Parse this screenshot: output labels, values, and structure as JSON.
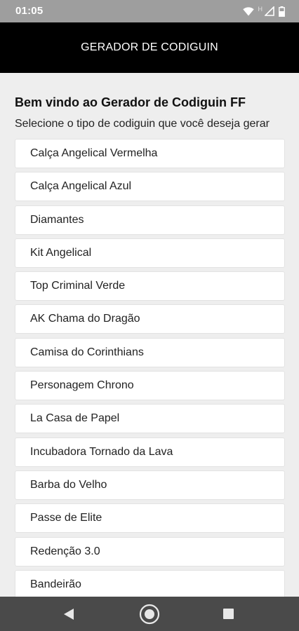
{
  "status_bar": {
    "time": "01:05",
    "network_label": "H",
    "icons": [
      "wifi-icon",
      "signal-icon",
      "battery-icon"
    ]
  },
  "app_bar": {
    "title": "GERADOR DE CODIGUIN"
  },
  "main": {
    "welcome": "Bem vindo ao Gerador de Codiguin FF",
    "subtitle": "Selecione o tipo de codiguin que você deseja gerar",
    "items": [
      "Calça Angelical Vermelha",
      "Calça Angelical Azul",
      "Diamantes",
      "Kit Angelical",
      "Top Criminal Verde",
      "AK Chama do Dragão",
      "Camisa do Corinthians",
      "Personagem Chrono",
      "La Casa de Papel",
      "Incubadora Tornado da Lava",
      "Barba do Velho",
      "Passe de Elite",
      "Redenção 3.0",
      "Bandeirão"
    ]
  },
  "nav_bar": {
    "icons": [
      "back-icon",
      "home-icon",
      "recents-icon"
    ]
  },
  "colors": {
    "status_bar": "#9e9e9e",
    "app_bar": "#000000",
    "background": "#eeeeee",
    "nav_bar": "#4a4a4a"
  }
}
